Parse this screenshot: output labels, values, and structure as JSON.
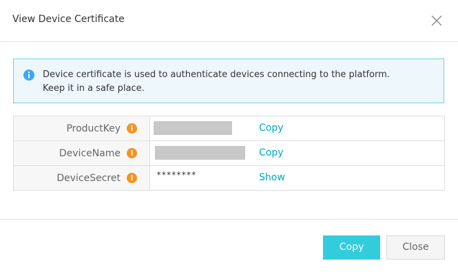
{
  "dialog": {
    "title": "View Device Certificate",
    "close_icon": "close-icon"
  },
  "notice": {
    "icon": "info-icon",
    "line1": "Device certificate is used to authenticate devices connecting to the platform.",
    "line2": "Keep it in a safe place."
  },
  "table": {
    "rows": [
      {
        "label": "ProductKey",
        "info": "i",
        "value": "",
        "action": "Copy"
      },
      {
        "label": "DeviceName",
        "info": "i",
        "value": "",
        "action": "Copy"
      },
      {
        "label": "DeviceSecret",
        "info": "i",
        "value": "********",
        "action": "Show"
      }
    ]
  },
  "footer": {
    "copy_label": "Copy",
    "close_label": "Close"
  },
  "colors": {
    "accent": "#33ccdd",
    "link": "#00a8c7",
    "info_orange": "#f5931f",
    "notice_blue": "#3da8f5"
  }
}
